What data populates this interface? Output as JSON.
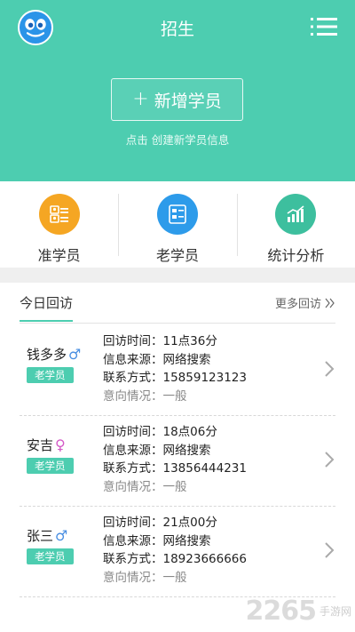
{
  "header": {
    "title": "招生",
    "add_button_label": "新增学员",
    "add_button_plus": "+",
    "add_hint": "点击 创建新学员信息",
    "colors": {
      "primary": "#4dcdb0",
      "logo": "#2b94e8"
    }
  },
  "quick_actions": [
    {
      "label": "准学员",
      "icon": "prospective-student-icon",
      "color": "#f5a623"
    },
    {
      "label": "老学员",
      "icon": "existing-student-icon",
      "color": "#2d9bea"
    },
    {
      "label": "统计分析",
      "icon": "chart-icon",
      "color": "#3dbf9e"
    }
  ],
  "visits": {
    "title": "今日回访",
    "more_label": "更多回访",
    "items": [
      {
        "name": "钱多多",
        "gender": "♂",
        "badge": "老学员",
        "time_label": "回访时间：",
        "time": "11点36分",
        "source_label": "信息来源：",
        "source": "网络搜索",
        "contact_label": "联系方式：",
        "contact": "15859123123",
        "intent_label": "意向情况：",
        "intent": "一般"
      },
      {
        "name": "安吉",
        "gender": "♀",
        "badge": "老学员",
        "time_label": "回访时间：",
        "time": "18点06分",
        "source_label": "信息来源：",
        "source": "网络搜索",
        "contact_label": "联系方式：",
        "contact": "13856444231",
        "intent_label": "意向情况：",
        "intent": "一般"
      },
      {
        "name": "张三",
        "gender": "♂",
        "badge": "老学员",
        "time_label": "回访时间：",
        "time": "21点00分",
        "source_label": "信息来源：",
        "source": "网络搜索",
        "contact_label": "联系方式：",
        "contact": "18923666666",
        "intent_label": "意向情况：",
        "intent": "一般"
      }
    ]
  },
  "watermark": {
    "number": "2265",
    "text": "手游网"
  }
}
